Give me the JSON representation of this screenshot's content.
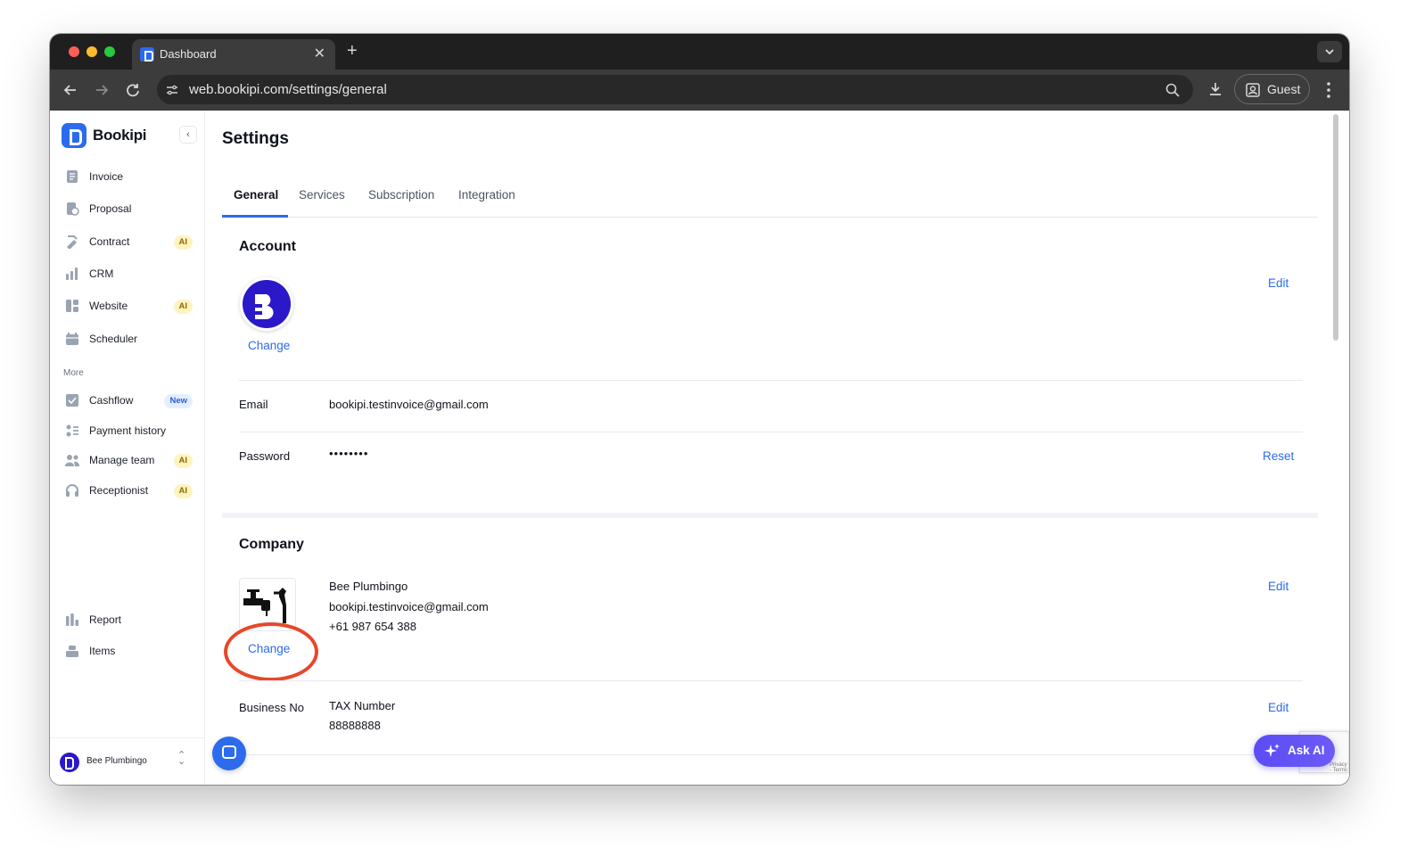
{
  "browser": {
    "tab_title": "Dashboard",
    "url": "web.bookipi.com/settings/general",
    "guest_label": "Guest"
  },
  "sidebar": {
    "brand": "Bookipi",
    "items": [
      {
        "label": "Invoice",
        "badge": ""
      },
      {
        "label": "Proposal",
        "badge": ""
      },
      {
        "label": "Contract",
        "badge": "AI"
      },
      {
        "label": "CRM",
        "badge": ""
      },
      {
        "label": "Website",
        "badge": "AI"
      },
      {
        "label": "Scheduler",
        "badge": ""
      }
    ],
    "more_label": "More",
    "more_items": [
      {
        "label": "Cashflow",
        "badge": "New"
      },
      {
        "label": "Payment history",
        "badge": ""
      },
      {
        "label": "Manage team",
        "badge": "AI"
      },
      {
        "label": "Receptionist",
        "badge": "AI"
      }
    ],
    "bottom_items": [
      {
        "label": "Report"
      },
      {
        "label": "Items"
      }
    ],
    "org_name": "Bee Plumbingo"
  },
  "main": {
    "title": "Settings",
    "tabs": [
      {
        "label": "General"
      },
      {
        "label": "Services"
      },
      {
        "label": "Subscription"
      },
      {
        "label": "Integration"
      }
    ],
    "account": {
      "title": "Account",
      "edit_label": "Edit",
      "change_label": "Change",
      "email_label": "Email",
      "email_value": "bookipi.testinvoice@gmail.com",
      "password_label": "Password",
      "password_value": "••••••••",
      "reset_label": "Reset"
    },
    "company": {
      "title": "Company",
      "edit_label": "Edit",
      "change_label": "Change",
      "name": "Bee Plumbingo",
      "email": "bookipi.testinvoice@gmail.com",
      "phone": "+61 987 654 388",
      "business_no_label": "Business No",
      "tax_label": "TAX Number",
      "tax_value": "88888888",
      "business_edit_label": "Edit"
    },
    "ask_ai_label": "Ask AI",
    "recaptcha_text": "Privacy - Terms"
  },
  "colors": {
    "accent": "#2c6bed",
    "highlight": "#e8472a",
    "ask_ai": "#5b4cf5"
  }
}
